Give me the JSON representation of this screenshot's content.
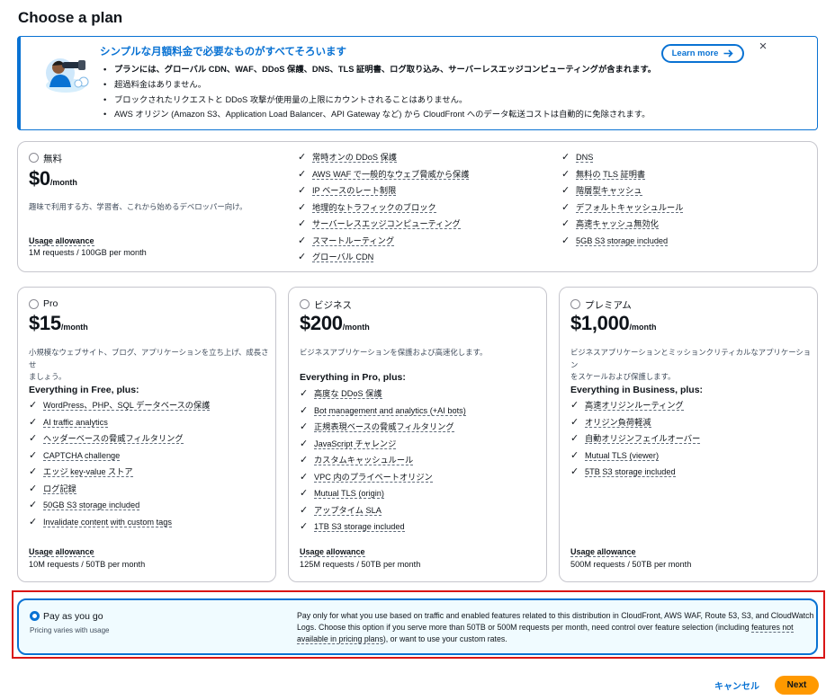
{
  "page": {
    "title": "Choose a plan"
  },
  "banner": {
    "title": "シンプルな月額料金で必要なものがすべてそろいます",
    "items": [
      "プランには、グローバル CDN、WAF、DDoS 保護、DNS、TLS 証明書、ログ取り込み、サーバーレスエッジコンピューティングが含まれます。",
      "超過料金はありません。",
      "ブロックされたリクエストと DDoS 攻撃が使用量の上限にカウントされることはありません。",
      "AWS オリジン (Amazon S3、Application Load Balancer、API Gateway など) から CloudFront へのデータ転送コストは自動的に免除されます。"
    ],
    "learn_more": "Learn more",
    "close_icon": "×"
  },
  "plans": {
    "free": {
      "name": "無料",
      "price": "$0",
      "per": "/month",
      "description": "趣味で利用する方、学習者、これから始めるデベロッパー向け。",
      "usage_label": "Usage allowance",
      "usage_value": "1M requests / 100GB per month",
      "features_col1": [
        "常時オンの DDoS 保護",
        "AWS WAF で一般的なウェブ脅威から保護",
        "IP ベースのレート制限",
        "地理的なトラフィックのブロック",
        "サーバーレスエッジコンピューティング",
        "スマートルーティング",
        "グローバル CDN"
      ],
      "features_col2": [
        "DNS",
        "無料の TLS 証明書",
        "階層型キャッシュ",
        "デフォルトキャッシュルール",
        "高速キャッシュ無効化",
        "5GB S3 storage included"
      ]
    },
    "pro": {
      "name": "Pro",
      "price": "$15",
      "per": "/month",
      "description_line1": "小規模なウェブサイト、ブログ、アプリケーションを立ち上げ、成長させ",
      "description_line2": "ましょう。",
      "everything": "Everything in Free, plus:",
      "features": [
        "WordPress、PHP、SQL データベースの保護",
        "AI traffic analytics",
        "ヘッダーベースの脅威フィルタリング",
        "CAPTCHA challenge",
        "エッジ key-value ストア",
        "ログ記録",
        "50GB S3 storage included",
        "Invalidate content with custom tags"
      ],
      "usage_label": "Usage allowance",
      "usage_value": "10M requests / 50TB per month"
    },
    "business": {
      "name": "ビジネス",
      "price": "$200",
      "per": "/month",
      "description": "ビジネスアプリケーションを保護および高速化します。",
      "everything": "Everything in Pro, plus:",
      "features": [
        "高度な DDoS 保護",
        "Bot management and analytics (+AI bots)",
        "正規表現ベースの脅威フィルタリング",
        "JavaScript チャレンジ",
        "カスタムキャッシュルール",
        "VPC 内のプライベートオリジン",
        "Mutual TLS (origin)",
        "アップタイム SLA",
        "1TB S3 storage included"
      ],
      "usage_label": "Usage allowance",
      "usage_value": "125M requests / 50TB per month"
    },
    "premium": {
      "name": "プレミアム",
      "price": "$1,000",
      "per": "/month",
      "description_line1": "ビジネスアプリケーションとミッションクリティカルなアプリケーション",
      "description_line2": "をスケールおよび保護します。",
      "everything": "Everything in Business, plus:",
      "features": [
        "高速オリジンルーティング",
        "オリジン負荷軽減",
        "自動オリジンフェイルオーバー",
        "Mutual TLS (viewer)",
        "5TB S3 storage included"
      ],
      "usage_label": "Usage allowance",
      "usage_value": "500M requests / 50TB per month"
    }
  },
  "payg": {
    "title": "Pay as you go",
    "subtitle": "Pricing varies with usage",
    "desc_part1": "Pay only for what you use based on traffic and enabled features related to this distribution in CloudFront, AWS WAF, Route 53, S3, and CloudWatch Logs. Choose this option if you serve more than 50TB or 500M requests per month, need control over feature selection (including ",
    "desc_link": "features not available in pricing plans",
    "desc_part2": "), or want to use your custom rates."
  },
  "footer": {
    "cancel": "キャンセル",
    "next": "Next"
  },
  "colors": {
    "accent": "#0972d3",
    "primary_button": "#ff9900",
    "highlight_outline": "#d91515"
  }
}
